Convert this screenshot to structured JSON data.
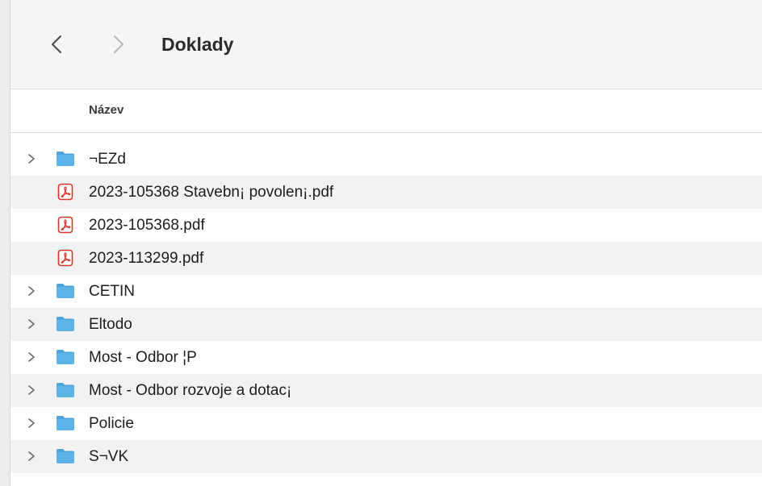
{
  "window": {
    "title": "Doklady",
    "back_icon": "chevron-left-icon",
    "forward_icon": "chevron-right-icon"
  },
  "columns": {
    "name": "Název"
  },
  "items": [
    {
      "name": "¬EZd",
      "kind": "folder"
    },
    {
      "name": "2023-105368 Stavebn¡ povolen¡.pdf",
      "kind": "pdf"
    },
    {
      "name": "2023-105368.pdf",
      "kind": "pdf"
    },
    {
      "name": "2023-113299.pdf",
      "kind": "pdf"
    },
    {
      "name": "CETIN",
      "kind": "folder"
    },
    {
      "name": "Eltodo",
      "kind": "folder"
    },
    {
      "name": "Most - Odbor ¦P",
      "kind": "folder"
    },
    {
      "name": "Most - Odbor rozvoje a dotac¡",
      "kind": "folder"
    },
    {
      "name": "Policie",
      "kind": "folder"
    },
    {
      "name": "S¬VK",
      "kind": "folder"
    }
  ],
  "colors": {
    "folder": "#5ab4e8",
    "folder_tab": "#4aa5dc",
    "pdf": "#e0322e",
    "row_alt": "#f2f2f2"
  }
}
